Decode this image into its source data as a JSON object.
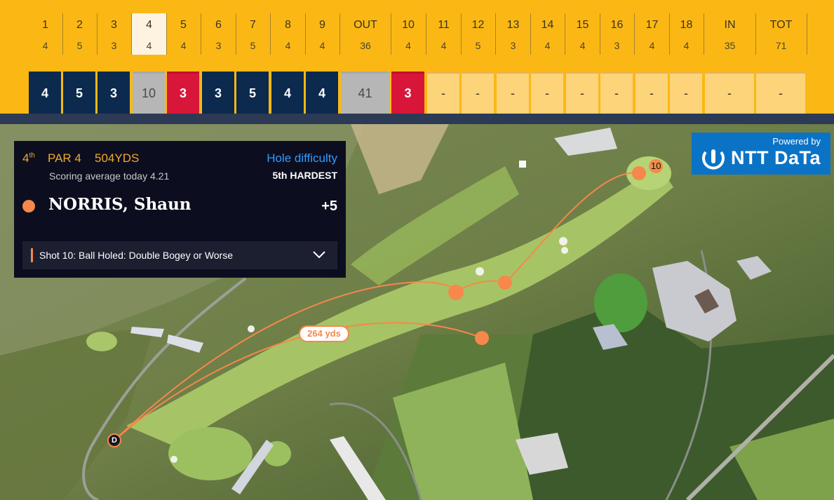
{
  "scorecard": {
    "holes": [
      {
        "label": "1",
        "par": "4",
        "score": "4",
        "style": "navy"
      },
      {
        "label": "2",
        "par": "5",
        "score": "5",
        "style": "navy"
      },
      {
        "label": "3",
        "par": "3",
        "score": "3",
        "style": "navy"
      },
      {
        "label": "4",
        "par": "4",
        "score": "10",
        "style": "grey",
        "current": true
      },
      {
        "label": "5",
        "par": "4",
        "score": "3",
        "style": "red"
      },
      {
        "label": "6",
        "par": "3",
        "score": "3",
        "style": "navy"
      },
      {
        "label": "7",
        "par": "5",
        "score": "5",
        "style": "navy"
      },
      {
        "label": "8",
        "par": "4",
        "score": "4",
        "style": "navy"
      },
      {
        "label": "9",
        "par": "4",
        "score": "4",
        "style": "navy"
      },
      {
        "label": "OUT",
        "par": "36",
        "score": "41",
        "style": "grey"
      },
      {
        "label": "10",
        "par": "4",
        "score": "3",
        "style": "red"
      },
      {
        "label": "11",
        "par": "4",
        "score": "-",
        "style": "empty"
      },
      {
        "label": "12",
        "par": "5",
        "score": "-",
        "style": "empty"
      },
      {
        "label": "13",
        "par": "3",
        "score": "-",
        "style": "empty"
      },
      {
        "label": "14",
        "par": "4",
        "score": "-",
        "style": "empty"
      },
      {
        "label": "15",
        "par": "4",
        "score": "-",
        "style": "empty"
      },
      {
        "label": "16",
        "par": "3",
        "score": "-",
        "style": "empty"
      },
      {
        "label": "17",
        "par": "4",
        "score": "-",
        "style": "empty"
      },
      {
        "label": "18",
        "par": "4",
        "score": "-",
        "style": "empty"
      },
      {
        "label": "IN",
        "par": "35",
        "score": "-",
        "style": "empty"
      },
      {
        "label": "TOT",
        "par": "71",
        "score": "-",
        "style": "empty"
      }
    ]
  },
  "hole_info": {
    "hole_ordinal": "4",
    "ordinal_suffix": "th",
    "par_text": "PAR 4",
    "yardage": "504YDS",
    "scoring_average": "Scoring average today 4.21",
    "difficulty_label": "Hole difficulty",
    "difficulty_value": "5th HARDEST",
    "player_name": "NORRIS, Shaun",
    "player_score": "+5",
    "shot_text": "Shot 10: Ball Holed: Double Bogey or Worse"
  },
  "sponsor": {
    "powered_by": "Powered by",
    "brand": "NTT DaTa"
  },
  "map": {
    "distance_label": "264 yds",
    "tee_label": "D",
    "last_shot_number": "10"
  },
  "colors": {
    "scorecard_bg": "#fbb814",
    "navy": "#0b2a4d",
    "red": "#d8163a",
    "shot_orange": "#f5884a",
    "difficulty_blue": "#2f9cff",
    "ntt_blue": "#0b73c6"
  }
}
